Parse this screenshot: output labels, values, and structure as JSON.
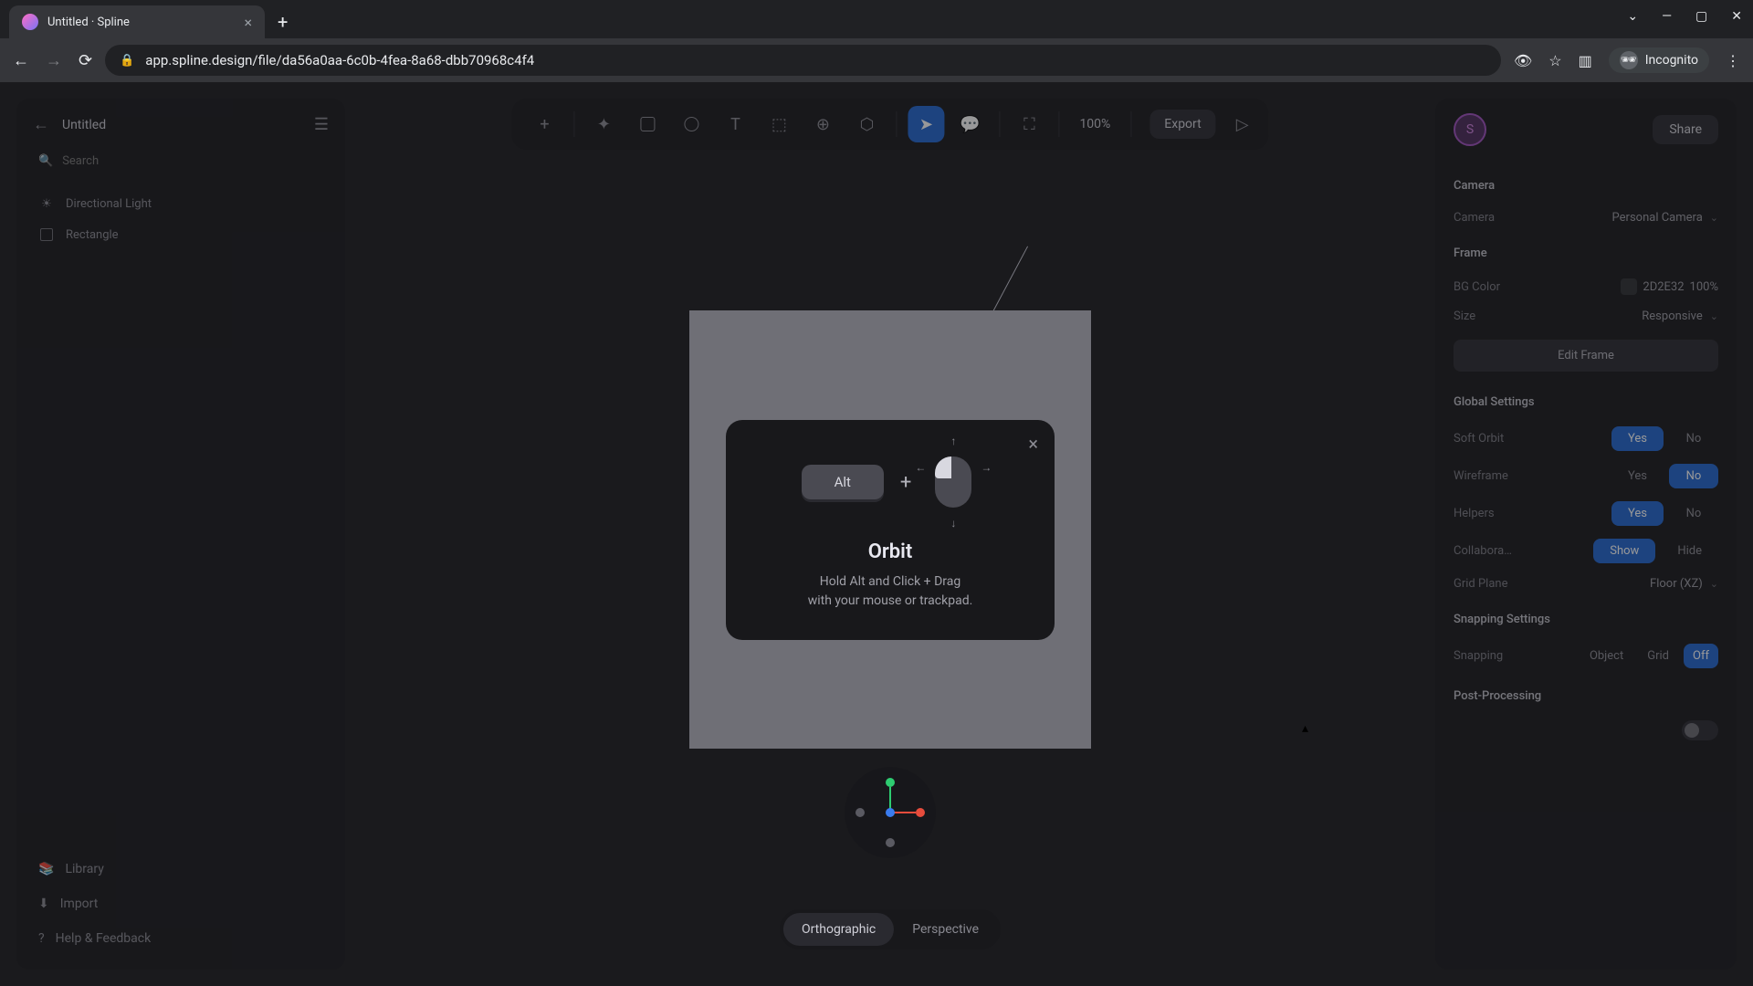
{
  "browser": {
    "tab_title": "Untitled · Spline",
    "url": "app.spline.design/file/da56a0aa-6c0b-4fea-8a68-dbb70968c4f4",
    "incognito_label": "Incognito"
  },
  "left_panel": {
    "back_icon": "←",
    "document_title": "Untitled",
    "search_placeholder": "Search",
    "hierarchy": [
      {
        "label": "Directional Light",
        "icon": "light"
      },
      {
        "label": "Rectangle",
        "icon": "rectangle"
      }
    ],
    "footer": {
      "library": "Library",
      "import": "Import",
      "help": "Help & Feedback"
    }
  },
  "toolbar": {
    "zoom": "100%",
    "export": "Export"
  },
  "orbit_modal": {
    "key_label": "Alt",
    "title": "Orbit",
    "desc_line1": "Hold Alt and Click + Drag",
    "desc_line2": "with your mouse or trackpad."
  },
  "view_toggle": {
    "orthographic": "Orthographic",
    "perspective": "Perspective"
  },
  "right_panel": {
    "avatar_letter": "S",
    "share": "Share",
    "camera": {
      "section": "Camera",
      "label": "Camera",
      "value": "Personal Camera"
    },
    "frame": {
      "section": "Frame",
      "bg_label": "BG Color",
      "bg_hex": "2D2E32",
      "bg_opacity": "100%",
      "size_label": "Size",
      "size_value": "Responsive",
      "edit_button": "Edit Frame"
    },
    "global": {
      "section": "Global Settings",
      "soft_orbit": {
        "label": "Soft Orbit",
        "yes": "Yes",
        "no": "No"
      },
      "wireframe": {
        "label": "Wireframe",
        "yes": "Yes",
        "no": "No"
      },
      "helpers": {
        "label": "Helpers",
        "yes": "Yes",
        "no": "No"
      },
      "collab": {
        "label": "Collabora…",
        "show": "Show",
        "hide": "Hide"
      },
      "grid_plane": {
        "label": "Grid Plane",
        "value": "Floor (XZ)"
      }
    },
    "snapping": {
      "section": "Snapping Settings",
      "label": "Snapping",
      "object": "Object",
      "grid": "Grid",
      "off": "Off"
    },
    "post": {
      "section": "Post-Processing"
    }
  }
}
